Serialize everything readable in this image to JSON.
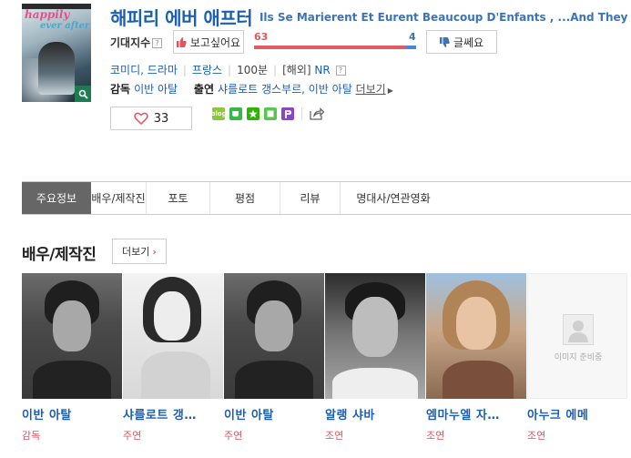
{
  "poster": {
    "title_line1": "happily",
    "title_line2": "ever after",
    "zoom_icon": "magnifier-icon"
  },
  "movie": {
    "title_ko": "해피리 에버 애프터",
    "title_original": "Ils Se Marierent Et Eurent Beaucoup D'Enfants , ...And They Lived Ha"
  },
  "expectation": {
    "label": "기대지수",
    "help": "?",
    "want_label": "보고싶어요",
    "not_label": "글쎄요",
    "want_count": "63",
    "not_count": "4",
    "want_fraction": 0.94,
    "want_color": "#e45a63",
    "not_color": "#4a86d6"
  },
  "meta": {
    "genre": "코미디, 드라마",
    "country": "프랑스",
    "runtime": "100분",
    "rating_prefix": "[해외]",
    "rating": "NR",
    "help": "?"
  },
  "people": {
    "director_label": "감독",
    "director": "이반 아탈",
    "cast_label": "출연",
    "cast": "샤를로트 갱스부르, 이반 아탈",
    "more_label": "더보기"
  },
  "like": {
    "count": "33"
  },
  "tabs": [
    {
      "label": "주요정보",
      "active": true
    },
    {
      "label": "배우/제작진"
    },
    {
      "label": "포토"
    },
    {
      "label": "평점"
    },
    {
      "label": "리뷰"
    },
    {
      "label": "명대사/연관영화"
    }
  ],
  "section": {
    "title": "배우/제작진",
    "more_label": "더보기"
  },
  "cast_list": [
    {
      "name": "이반 아탈",
      "role": "감독"
    },
    {
      "name": "샤를로트 갱…",
      "role": "주연"
    },
    {
      "name": "이반 아탈",
      "role": "주연"
    },
    {
      "name": "알랭 샤바",
      "role": "조연"
    },
    {
      "name": "엠마누엘 자…",
      "role": "조연"
    },
    {
      "name": "아누크 에메",
      "role": "조연",
      "no_image_text": "이미지 준비중"
    }
  ]
}
